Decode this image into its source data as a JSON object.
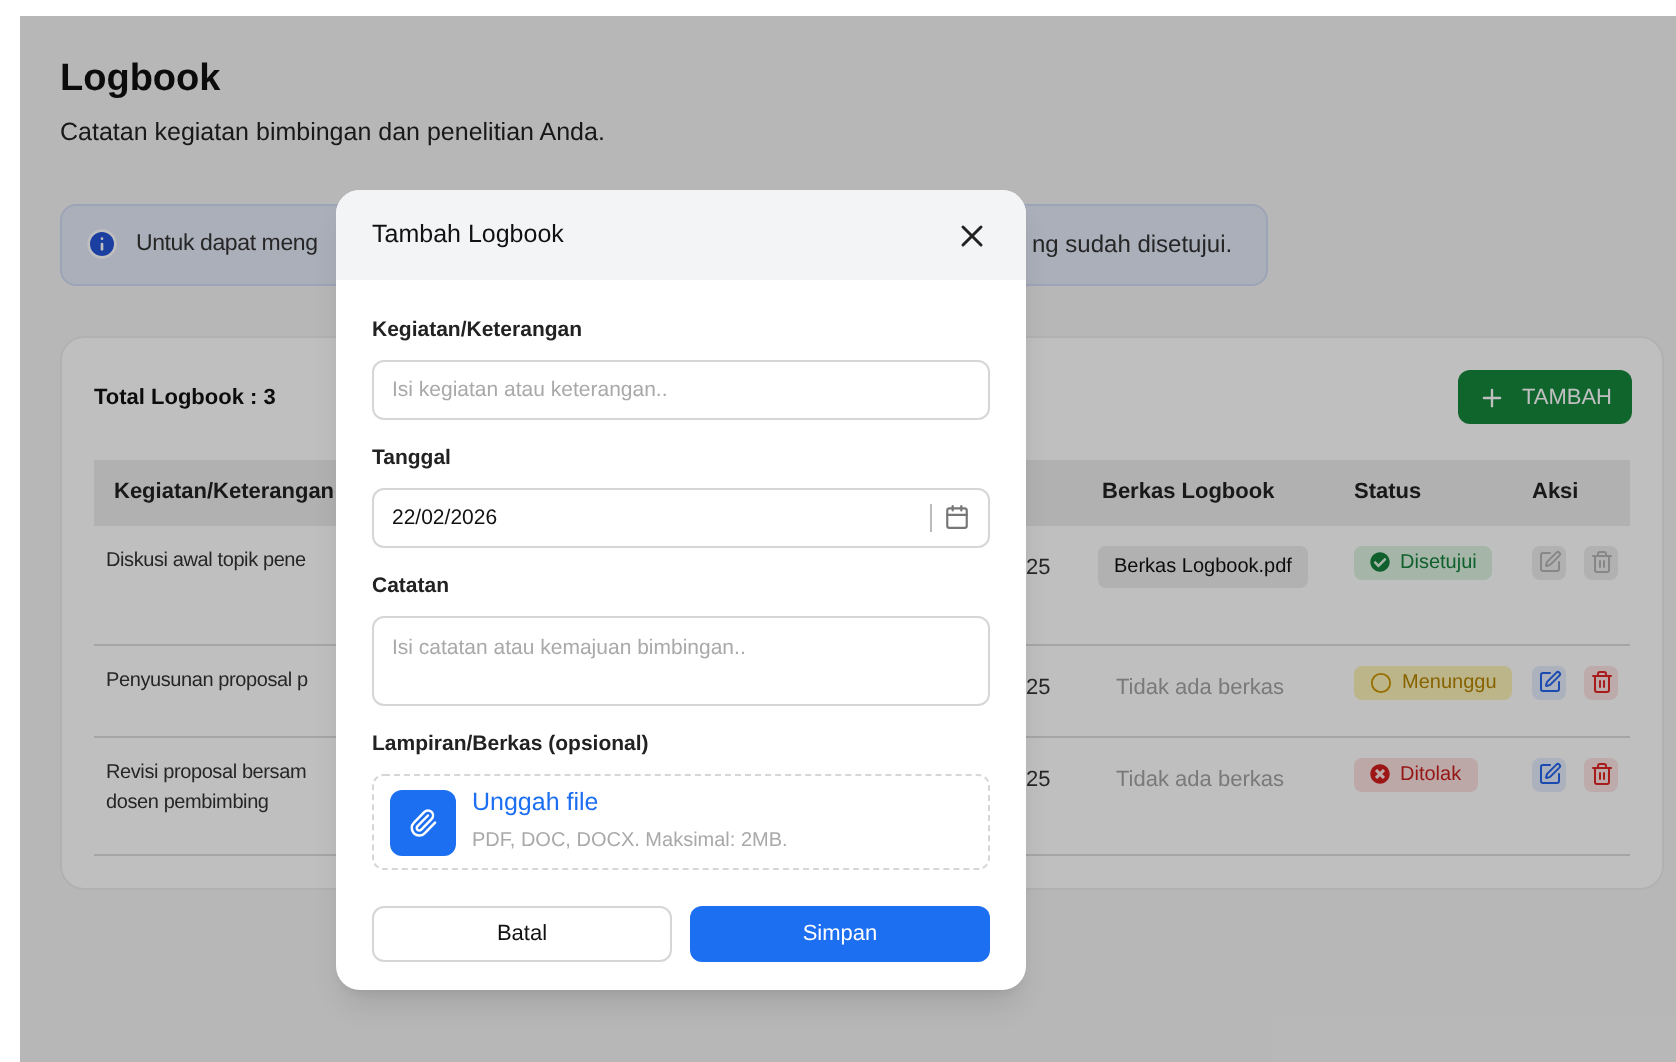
{
  "page": {
    "title": "Logbook",
    "subtitle": "Catatan kegiatan bimbingan dan penelitian Anda."
  },
  "info_banner": {
    "text_start": "Untuk dapat meng",
    "text_end": "ng sudah disetujui."
  },
  "card": {
    "total": "Total Logbook : 3",
    "add_button": "TAMBAH"
  },
  "table": {
    "columns": [
      "Kegiatan/Keterangan",
      "Berkas Logbook",
      "Status",
      "Aksi"
    ],
    "rows": [
      {
        "activity": [
          "Diskusi awal topik pene"
        ],
        "date": "25",
        "file": {
          "kind": "file",
          "label": "Berkas Logbook.pdf"
        },
        "status": {
          "kind": "approved",
          "label": "Disetujui"
        },
        "actions_disabled": true
      },
      {
        "activity": [
          "Penyusunan proposal p"
        ],
        "date": "25",
        "file": {
          "kind": "none",
          "label": "Tidak ada berkas"
        },
        "status": {
          "kind": "pending",
          "label": "Menunggu"
        },
        "actions_disabled": false
      },
      {
        "activity": [
          "Revisi proposal bersam",
          "dosen pembimbing"
        ],
        "date": "25",
        "file": {
          "kind": "none",
          "label": "Tidak ada berkas"
        },
        "status": {
          "kind": "rejected",
          "label": "Ditolak"
        },
        "actions_disabled": false
      }
    ]
  },
  "modal": {
    "title": "Tambah Logbook",
    "fields": [
      {
        "kind": "text",
        "label": "Kegiatan/Keterangan",
        "placeholder": "Isi kegiatan atau keterangan.."
      },
      {
        "kind": "date",
        "label": "Tanggal",
        "value": "22/02/2026"
      },
      {
        "kind": "textarea",
        "label": "Catatan",
        "placeholder": "Isi catatan atau kemajuan bimbingan.."
      },
      {
        "kind": "upload",
        "label": "Lampiran/Berkas (opsional)",
        "action": "Unggah file",
        "hint": "PDF, DOC, DOCX. Maksimal: 2MB."
      }
    ],
    "buttons": [
      {
        "kind": "secondary",
        "label": "Batal"
      },
      {
        "kind": "primary",
        "label": "Simpan"
      }
    ]
  }
}
